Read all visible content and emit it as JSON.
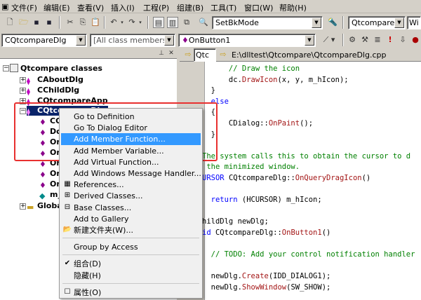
{
  "menubar": {
    "items": [
      "文件(F)",
      "编辑(E)",
      "查看(V)",
      "插入(I)",
      "工程(P)",
      "组建(B)",
      "工具(T)",
      "窗口(W)",
      "帮助(H)"
    ]
  },
  "toolbar1": {
    "config_combo": "SetBkMode",
    "project_combo": "Qtcompare",
    "platform_combo": "Wi"
  },
  "toolbar2": {
    "class_combo": "CQtcompareDlg",
    "filter_combo": "[All class members]",
    "member_combo": "OnButton1"
  },
  "leftpane": {
    "tree": {
      "root": "Qtcompare classes",
      "nodes": [
        {
          "label": "CAboutDlg"
        },
        {
          "label": "CChildDlg"
        },
        {
          "label": "CQtcompareApp"
        },
        {
          "label": "CQtcompareDlg"
        }
      ],
      "children": [
        "CQ",
        "Do",
        "On",
        "On",
        "On",
        "On",
        "On",
        "m_"
      ],
      "globals": "Globa"
    }
  },
  "editor": {
    "path": "E:\\dlltest\\Qtcompare\\QtcompareDlg.cpp",
    "nav_combo": "Qtc"
  },
  "code_lines": [
    {
      "type": "cm",
      "text": "      // Draw the icon"
    },
    {
      "type": "mix",
      "parts": [
        [
          "",
          "      dc."
        ],
        [
          "fn",
          "DrawIcon"
        ],
        [
          "",
          "(x, y, m_hIcon);"
        ]
      ]
    },
    {
      "type": "plain",
      "text": "  }"
    },
    {
      "type": "kw",
      "text": "  else"
    },
    {
      "type": "plain",
      "text": "  {"
    },
    {
      "type": "mix",
      "parts": [
        [
          "",
          "      CDialog::"
        ],
        [
          "fn",
          "OnPaint"
        ],
        [
          "",
          "();"
        ]
      ]
    },
    {
      "type": "plain",
      "text": "  }"
    },
    {
      "type": "plain",
      "text": ""
    },
    {
      "type": "cm",
      "text": "The system calls this to obtain the cursor to d"
    },
    {
      "type": "cm",
      "text": " the minimized window."
    },
    {
      "type": "mix",
      "parts": [
        [
          "kw",
          "URSOR "
        ],
        [
          "",
          "CQtcompareDlg::"
        ],
        [
          "fn",
          "OnQueryDragIcon"
        ],
        [
          "",
          "()"
        ]
      ]
    },
    {
      "type": "plain",
      "text": ""
    },
    {
      "type": "mix",
      "parts": [
        [
          "kw",
          "  return "
        ],
        [
          "",
          "(HCURSOR) m_hIcon;"
        ]
      ]
    },
    {
      "type": "plain",
      "text": ""
    },
    {
      "type": "plain",
      "text": "hildDlg newDlg;"
    },
    {
      "type": "mix",
      "parts": [
        [
          "kw",
          "id "
        ],
        [
          "",
          "CQtcompareDlg::"
        ],
        [
          "fn",
          "OnButton1"
        ],
        [
          "",
          "()"
        ]
      ]
    },
    {
      "type": "plain",
      "text": ""
    },
    {
      "type": "cm",
      "text": "  // TODO: Add your control notification handler"
    },
    {
      "type": "plain",
      "text": ""
    },
    {
      "type": "mix",
      "parts": [
        [
          "",
          "  newDlg."
        ],
        [
          "fn",
          "Create"
        ],
        [
          "",
          "(IDD_DIALOG1);"
        ]
      ]
    },
    {
      "type": "mix",
      "parts": [
        [
          "",
          "  newDlg."
        ],
        [
          "fn",
          "ShowWindow"
        ],
        [
          "",
          "(SW_SHOW);"
        ]
      ]
    }
  ],
  "context_menu": {
    "items": [
      {
        "label": "Go to Definition",
        "icon": ""
      },
      {
        "label": "Go To Dialog Editor",
        "icon": ""
      },
      {
        "label": "Add Member Function...",
        "icon": "",
        "highlighted": true
      },
      {
        "label": "Add Member Variable...",
        "icon": ""
      },
      {
        "label": "Add Virtual Function...",
        "icon": ""
      },
      {
        "label": "Add Windows Message Handler...",
        "icon": ""
      },
      {
        "label": "References...",
        "icon": "references-icon"
      },
      {
        "label": "Derived Classes...",
        "icon": "derived-classes-icon"
      },
      {
        "label": "Base Classes...",
        "icon": "base-classes-icon"
      },
      {
        "label": "Add to Gallery",
        "icon": ""
      },
      {
        "label": "新建文件夹(W)...",
        "icon": "folder-icon"
      },
      {
        "sep": true
      },
      {
        "label": "Group by Access",
        "icon": ""
      },
      {
        "sep": true
      },
      {
        "label": "组合(D)",
        "icon": "checkmark-icon"
      },
      {
        "label": "隐藏(H)",
        "icon": ""
      },
      {
        "sep": true
      },
      {
        "label": "属性(O)",
        "icon": "properties-icon"
      }
    ]
  },
  "colors": {
    "highlight": "#3399ff",
    "annotation_box": "#e8302f",
    "keyword": "#0000ff",
    "comment": "#008000"
  }
}
